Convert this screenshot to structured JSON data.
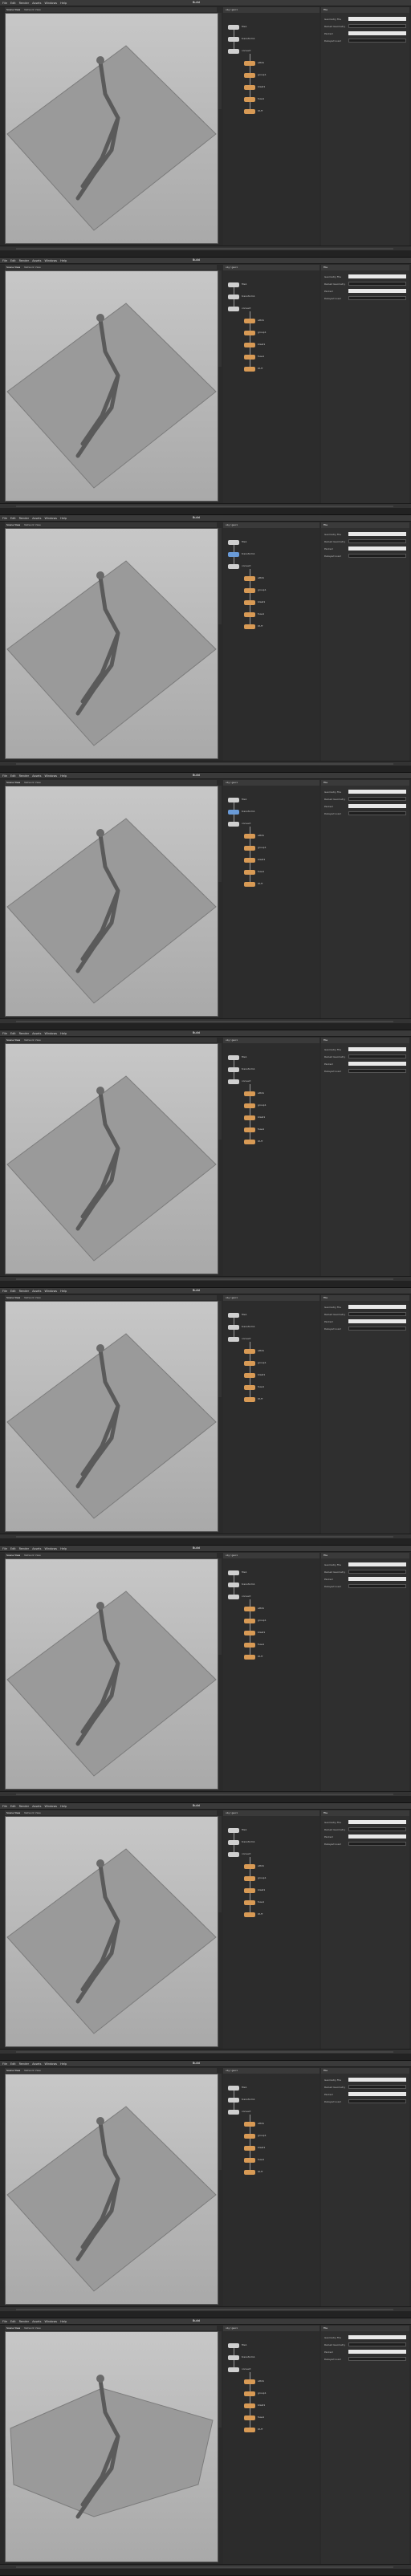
{
  "app": {
    "menu": [
      "File",
      "Edit",
      "Render",
      "Assets",
      "Windows",
      "Help"
    ],
    "desk_label": "Build"
  },
  "colors": {
    "viewport_top": "#c7c7c7",
    "viewport_bottom": "#a9a9a9",
    "node_gray": "#cfcfcf",
    "node_orange": "#d89a55",
    "node_blue": "#6a9bd8",
    "panel_bg": "#2c2c2c"
  },
  "frames": [
    {
      "view_tabs": [
        "Scene View",
        "Network View"
      ],
      "net_path": "obj / geo1",
      "params_title": "File",
      "nodes": [
        {
          "label": "file1",
          "color": "#d0d0d0"
        },
        {
          "label": "transform1",
          "color": "#d0d0d0"
        },
        {
          "label": "convert",
          "color": "#d0d0d0"
        },
        {
          "label": "attrib",
          "color": "#d89a55"
        },
        {
          "label": "group1",
          "color": "#d89a55"
        },
        {
          "label": "blast1",
          "color": "#d89a55"
        },
        {
          "label": "fuse1",
          "color": "#d89a55"
        },
        {
          "label": "OUT",
          "color": "#d89a55"
        }
      ],
      "params": [
        {
          "label": "Geometry File",
          "value": "",
          "dark": false
        },
        {
          "label": "Reload Geometry",
          "value": "",
          "dark": true
        },
        {
          "label": "Packed",
          "value": "",
          "dark": false
        },
        {
          "label": "Delayed Load",
          "value": "",
          "dark": true
        }
      ],
      "status": ""
    },
    {
      "view_tabs": [
        "Scene View",
        "Network View"
      ],
      "net_path": "obj / geo1",
      "params_title": "File",
      "nodes": [
        {
          "label": "file1",
          "color": "#d0d0d0"
        },
        {
          "label": "transform1",
          "color": "#d0d0d0"
        },
        {
          "label": "convert",
          "color": "#d0d0d0"
        },
        {
          "label": "attrib",
          "color": "#d89a55"
        },
        {
          "label": "group1",
          "color": "#d89a55"
        },
        {
          "label": "blast1",
          "color": "#d89a55"
        },
        {
          "label": "fuse1",
          "color": "#d89a55"
        },
        {
          "label": "OUT",
          "color": "#d89a55"
        }
      ],
      "params": [
        {
          "label": "Geometry File",
          "value": "",
          "dark": false
        },
        {
          "label": "Reload Geometry",
          "value": "",
          "dark": true
        },
        {
          "label": "Packed",
          "value": "",
          "dark": false
        },
        {
          "label": "Delayed Load",
          "value": "",
          "dark": true
        }
      ],
      "status": ""
    },
    {
      "view_tabs": [
        "Scene View",
        "Network View"
      ],
      "net_path": "obj / geo1",
      "params_title": "File",
      "nodes": [
        {
          "label": "file1",
          "color": "#d0d0d0"
        },
        {
          "label": "transform1",
          "color": "#6a9bd8"
        },
        {
          "label": "convert",
          "color": "#d0d0d0"
        },
        {
          "label": "attrib",
          "color": "#d89a55"
        },
        {
          "label": "group1",
          "color": "#d89a55"
        },
        {
          "label": "blast1",
          "color": "#d89a55"
        },
        {
          "label": "fuse1",
          "color": "#d89a55"
        },
        {
          "label": "OUT",
          "color": "#d89a55"
        }
      ],
      "params": [
        {
          "label": "Geometry File",
          "value": "",
          "dark": false
        },
        {
          "label": "Reload Geometry",
          "value": "",
          "dark": true
        },
        {
          "label": "Packed",
          "value": "",
          "dark": false
        },
        {
          "label": "Delayed Load",
          "value": "",
          "dark": true
        }
      ],
      "status": ""
    },
    {
      "view_tabs": [
        "Scene View",
        "Network View"
      ],
      "net_path": "obj / geo1",
      "params_title": "File",
      "nodes": [
        {
          "label": "file1",
          "color": "#d0d0d0"
        },
        {
          "label": "transform1",
          "color": "#6a9bd8"
        },
        {
          "label": "convert",
          "color": "#d0d0d0"
        },
        {
          "label": "attrib",
          "color": "#d89a55"
        },
        {
          "label": "group1",
          "color": "#d89a55"
        },
        {
          "label": "blast1",
          "color": "#d89a55"
        },
        {
          "label": "fuse1",
          "color": "#d89a55"
        },
        {
          "label": "OUT",
          "color": "#d89a55"
        }
      ],
      "params": [
        {
          "label": "Geometry File",
          "value": "",
          "dark": false
        },
        {
          "label": "Reload Geometry",
          "value": "",
          "dark": true
        },
        {
          "label": "Packed",
          "value": "",
          "dark": false
        },
        {
          "label": "Delayed Load",
          "value": "",
          "dark": true
        }
      ],
      "status": ""
    },
    {
      "view_tabs": [
        "Scene View",
        "Network View"
      ],
      "net_path": "obj / geo1",
      "params_title": "File",
      "nodes": [
        {
          "label": "file1",
          "color": "#d0d0d0"
        },
        {
          "label": "transform1",
          "color": "#d0d0d0"
        },
        {
          "label": "convert",
          "color": "#d0d0d0"
        },
        {
          "label": "attrib",
          "color": "#d89a55"
        },
        {
          "label": "group1",
          "color": "#d89a55"
        },
        {
          "label": "blast1",
          "color": "#d89a55"
        },
        {
          "label": "fuse1",
          "color": "#d89a55"
        },
        {
          "label": "OUT",
          "color": "#d89a55"
        }
      ],
      "params": [
        {
          "label": "Geometry File",
          "value": "",
          "dark": false
        },
        {
          "label": "Reload Geometry",
          "value": "",
          "dark": true
        },
        {
          "label": "Packed",
          "value": "",
          "dark": false
        },
        {
          "label": "Delayed Load",
          "value": "",
          "dark": true
        }
      ],
      "status": ""
    },
    {
      "view_tabs": [
        "Scene View",
        "Network View"
      ],
      "net_path": "obj / geo1",
      "params_title": "File",
      "nodes": [
        {
          "label": "file1",
          "color": "#d0d0d0"
        },
        {
          "label": "transform1",
          "color": "#d0d0d0"
        },
        {
          "label": "convert",
          "color": "#d0d0d0"
        },
        {
          "label": "attrib",
          "color": "#d89a55"
        },
        {
          "label": "group1",
          "color": "#d89a55"
        },
        {
          "label": "blast1",
          "color": "#d89a55"
        },
        {
          "label": "fuse1",
          "color": "#d89a55"
        },
        {
          "label": "OUT",
          "color": "#d89a55"
        }
      ],
      "params": [
        {
          "label": "Geometry File",
          "value": "",
          "dark": false
        },
        {
          "label": "Reload Geometry",
          "value": "",
          "dark": true
        },
        {
          "label": "Packed",
          "value": "",
          "dark": false
        },
        {
          "label": "Delayed Load",
          "value": "",
          "dark": true
        }
      ],
      "status": ""
    },
    {
      "view_tabs": [
        "Scene View",
        "Network View"
      ],
      "net_path": "obj / geo1",
      "params_title": "File",
      "nodes": [
        {
          "label": "file1",
          "color": "#d0d0d0"
        },
        {
          "label": "transform1",
          "color": "#d0d0d0"
        },
        {
          "label": "convert",
          "color": "#d0d0d0"
        },
        {
          "label": "attrib",
          "color": "#d89a55"
        },
        {
          "label": "group1",
          "color": "#d89a55"
        },
        {
          "label": "blast1",
          "color": "#d89a55"
        },
        {
          "label": "fuse1",
          "color": "#d89a55"
        },
        {
          "label": "OUT",
          "color": "#d89a55"
        }
      ],
      "params": [
        {
          "label": "Geometry File",
          "value": "",
          "dark": false
        },
        {
          "label": "Reload Geometry",
          "value": "",
          "dark": true
        },
        {
          "label": "Packed",
          "value": "",
          "dark": false
        },
        {
          "label": "Delayed Load",
          "value": "",
          "dark": true
        }
      ],
      "status": ""
    },
    {
      "view_tabs": [
        "Scene View",
        "Network View"
      ],
      "net_path": "obj / geo1",
      "params_title": "File",
      "nodes": [
        {
          "label": "file1",
          "color": "#d0d0d0"
        },
        {
          "label": "transform1",
          "color": "#d0d0d0"
        },
        {
          "label": "convert",
          "color": "#d0d0d0"
        },
        {
          "label": "attrib",
          "color": "#d89a55"
        },
        {
          "label": "group1",
          "color": "#d89a55"
        },
        {
          "label": "blast1",
          "color": "#d89a55"
        },
        {
          "label": "fuse1",
          "color": "#d89a55"
        },
        {
          "label": "OUT",
          "color": "#d89a55"
        }
      ],
      "params": [
        {
          "label": "Geometry File",
          "value": "",
          "dark": false
        },
        {
          "label": "Reload Geometry",
          "value": "",
          "dark": true
        },
        {
          "label": "Packed",
          "value": "",
          "dark": false
        },
        {
          "label": "Delayed Load",
          "value": "",
          "dark": true
        }
      ],
      "status": ""
    },
    {
      "view_tabs": [
        "Scene View",
        "Network View"
      ],
      "net_path": "obj / geo1",
      "params_title": "File",
      "nodes": [
        {
          "label": "file1",
          "color": "#d0d0d0"
        },
        {
          "label": "transform1",
          "color": "#d0d0d0"
        },
        {
          "label": "convert",
          "color": "#d0d0d0"
        },
        {
          "label": "attrib",
          "color": "#d89a55"
        },
        {
          "label": "group1",
          "color": "#d89a55"
        },
        {
          "label": "blast1",
          "color": "#d89a55"
        },
        {
          "label": "fuse1",
          "color": "#d89a55"
        },
        {
          "label": "OUT",
          "color": "#d89a55"
        }
      ],
      "params": [
        {
          "label": "Geometry File",
          "value": "",
          "dark": false
        },
        {
          "label": "Reload Geometry",
          "value": "",
          "dark": true
        },
        {
          "label": "Packed",
          "value": "",
          "dark": false
        },
        {
          "label": "Delayed Load",
          "value": "",
          "dark": true
        }
      ],
      "status": ""
    },
    {
      "view_tabs": [
        "Scene View",
        "Network View"
      ],
      "net_path": "obj / geo1",
      "params_title": "File",
      "nodes": [
        {
          "label": "file1",
          "color": "#d0d0d0"
        },
        {
          "label": "transform1",
          "color": "#d0d0d0"
        },
        {
          "label": "convert",
          "color": "#d0d0d0"
        },
        {
          "label": "attrib",
          "color": "#d89a55"
        },
        {
          "label": "group1",
          "color": "#d89a55"
        },
        {
          "label": "blast1",
          "color": "#d89a55"
        },
        {
          "label": "fuse1",
          "color": "#d89a55"
        },
        {
          "label": "OUT",
          "color": "#d89a55"
        }
      ],
      "params": [
        {
          "label": "Geometry File",
          "value": "",
          "dark": false
        },
        {
          "label": "Reload Geometry",
          "value": "",
          "dark": true
        },
        {
          "label": "Packed",
          "value": "",
          "dark": false
        },
        {
          "label": "Delayed Load",
          "value": "",
          "dark": true
        }
      ],
      "status": ""
    }
  ]
}
